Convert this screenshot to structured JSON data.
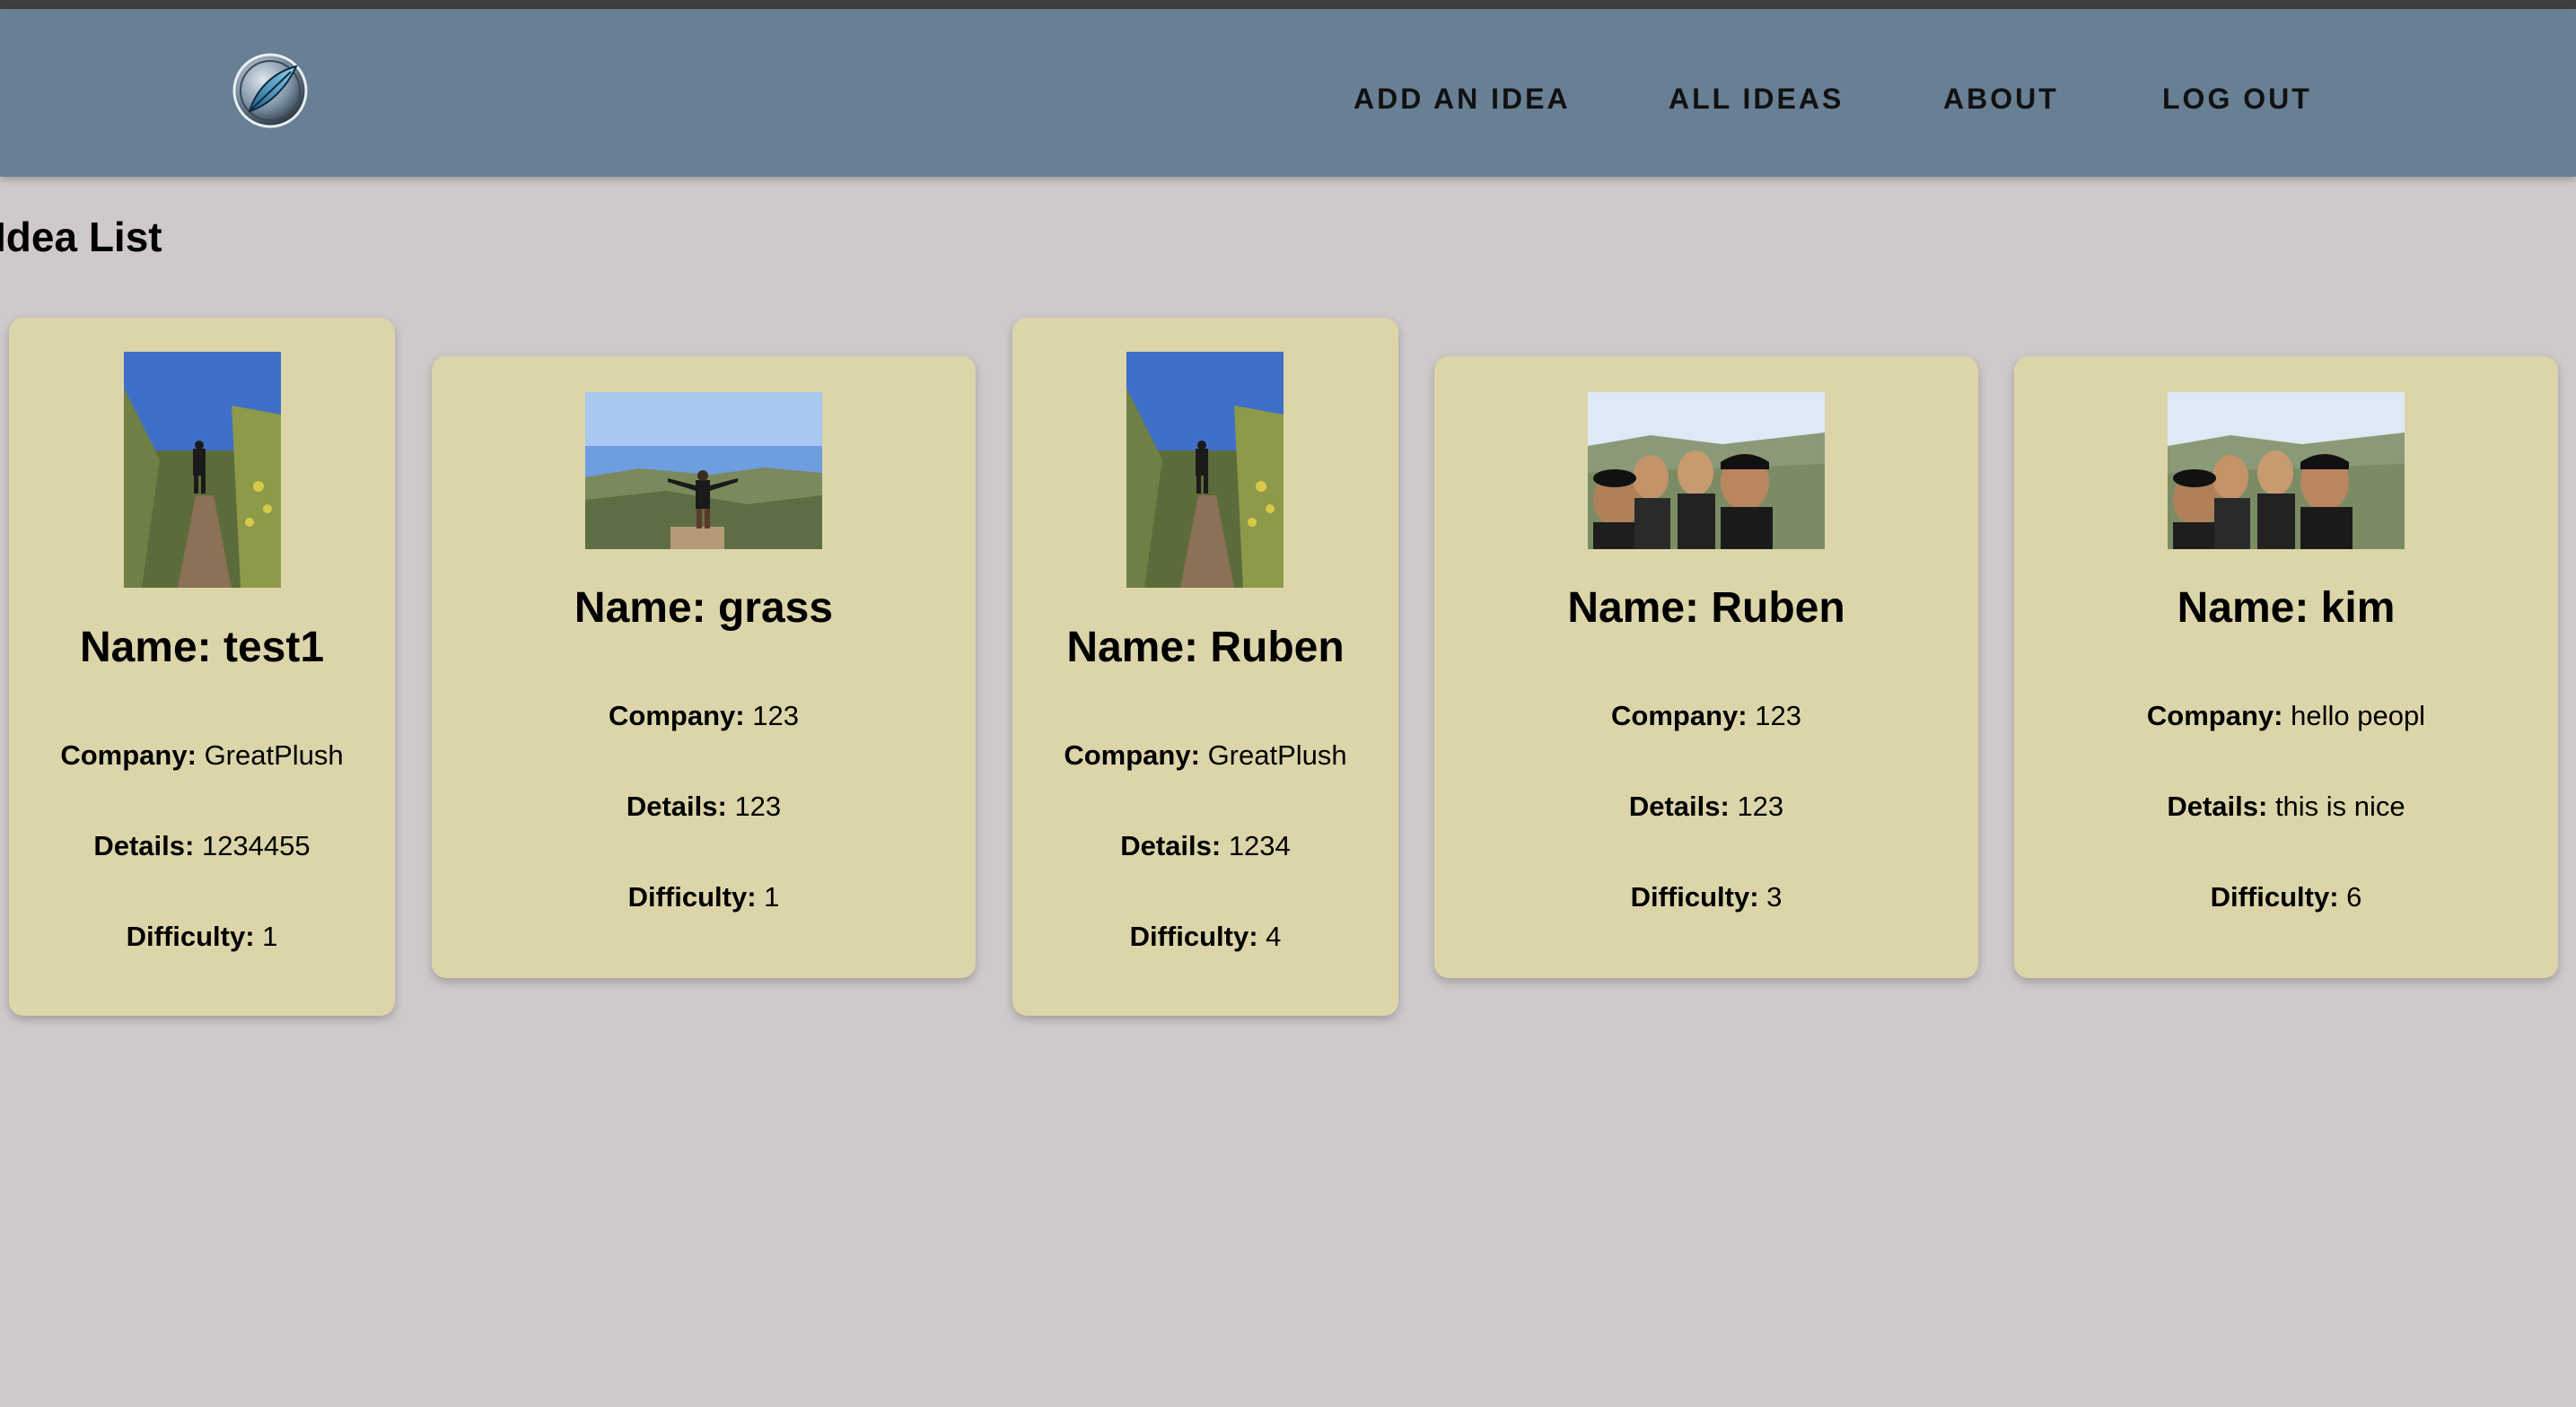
{
  "nav": {
    "links": [
      {
        "label": "ADD AN IDEA"
      },
      {
        "label": "ALL IDEAS"
      },
      {
        "label": "ABOUT"
      },
      {
        "label": "LOG OUT"
      }
    ]
  },
  "page": {
    "title": "Idea List"
  },
  "labels": {
    "company": "Company:",
    "details": "Details:",
    "difficulty": "Difficulty:"
  },
  "cards": [
    {
      "name": "Name: test1",
      "company": "GreatPlush",
      "details": "1234455",
      "difficulty": "1",
      "photo": "hiking-trail-photo"
    },
    {
      "name": "Name: grass",
      "company": "123",
      "details": "123",
      "difficulty": "1",
      "photo": "hilltop-person-photo"
    },
    {
      "name": "Name: Ruben",
      "company": "GreatPlush",
      "details": "1234",
      "difficulty": "4",
      "photo": "hiking-trail-photo"
    },
    {
      "name": "Name: Ruben",
      "company": "123",
      "details": "123",
      "difficulty": "3",
      "photo": "group-selfie-photo"
    },
    {
      "name": "Name: kim",
      "company": "hello peopl",
      "details": "this is nice",
      "difficulty": "6",
      "photo": "group-selfie-photo"
    }
  ],
  "colors": {
    "navbar": "#687f94",
    "background": "#cfc9c9",
    "card": "#dcd5aa"
  }
}
